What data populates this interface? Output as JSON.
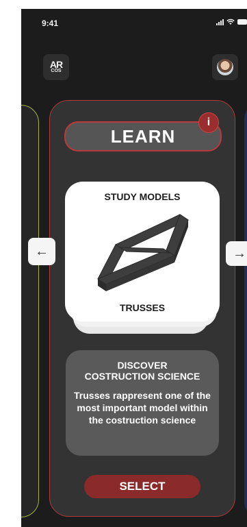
{
  "status_bar": {
    "time": "9:41"
  },
  "logo": {
    "top": "AR",
    "bottom": "COS"
  },
  "main_card": {
    "header": "LEARN",
    "info_label": "i",
    "model": {
      "title": "STUDY MODELS",
      "subtitle": "TRUSSES"
    },
    "description": {
      "title_line1": "DISCOVER",
      "title_line2": "COSTRUCTION SCIENCE",
      "body": "Trusses rappresent one of the most important model within the costruction science"
    },
    "select_label": "SELECT"
  },
  "nav": {
    "prev_symbol": "←",
    "next_symbol": "→"
  },
  "colors": {
    "background": "#1c1c1c",
    "accent_red": "#b33a3a",
    "button_red": "#8a2a2a",
    "side_card_border": "#a6b53a"
  },
  "icons": {
    "logo": "ar-cos-logo-icon",
    "avatar": "user-avatar-icon",
    "info": "info-icon",
    "prev": "arrow-left-icon",
    "next": "arrow-right-icon",
    "model": "truss-model-icon"
  }
}
